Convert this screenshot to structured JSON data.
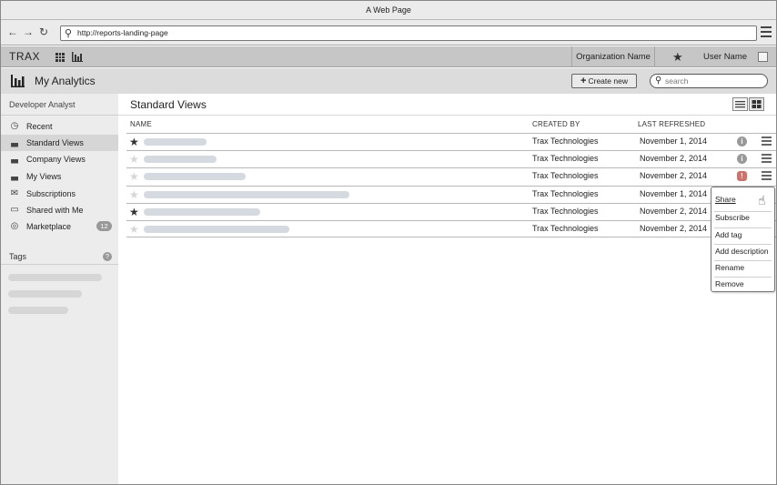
{
  "browser": {
    "title": "A Web Page",
    "url": "http://reports-landing-page"
  },
  "topbar": {
    "brand": "TRAX",
    "organization": "Organization Name",
    "user_name": "User Name"
  },
  "page_header": {
    "title": "My Analytics",
    "create_label": "Create new",
    "search_placeholder": "search"
  },
  "sidebar": {
    "user_role": "Developer Analyst",
    "items": [
      {
        "label": "Recent",
        "icon": "clock-icon"
      },
      {
        "label": "Standard Views",
        "icon": "bar-chart-icon",
        "active": true
      },
      {
        "label": "Company Views",
        "icon": "bar-chart-icon"
      },
      {
        "label": "My Views",
        "icon": "bar-chart-icon"
      },
      {
        "label": "Subscriptions",
        "icon": "envelope-icon"
      },
      {
        "label": "Shared with Me",
        "icon": "inbox-icon"
      },
      {
        "label": "Marketplace",
        "icon": "globe-icon",
        "badge": "12"
      }
    ],
    "tags_label": "Tags"
  },
  "main": {
    "title": "Standard Views",
    "columns": {
      "name": "NAME",
      "created_by": "CREATED BY",
      "last_refreshed": "LAST REFRESHED"
    },
    "rows": [
      {
        "starred": true,
        "created_by": "Trax Technologies",
        "last_refreshed": "November 1, 2014",
        "status": "info"
      },
      {
        "starred": false,
        "created_by": "Trax Technologies",
        "last_refreshed": "November 2, 2014",
        "status": "info"
      },
      {
        "starred": false,
        "created_by": "Trax Technologies",
        "last_refreshed": "November 2, 2014",
        "status": "alert"
      },
      {
        "starred": false,
        "created_by": "Trax Technologies",
        "last_refreshed": "November 1, 2014",
        "status": "none"
      },
      {
        "starred": true,
        "created_by": "Trax Technologies",
        "last_refreshed": "November 2, 2014",
        "status": "none"
      },
      {
        "starred": false,
        "created_by": "Trax Technologies",
        "last_refreshed": "November 2, 2014",
        "status": "none"
      }
    ]
  },
  "row_menu": {
    "items": [
      "Share",
      "Subscribe",
      "Add tag",
      "Add description",
      "Rename",
      "Remove"
    ]
  },
  "colors": {
    "app_bar": "#c6c6c6",
    "sidebar_bg": "#ececec",
    "alert": "#c9756d"
  }
}
